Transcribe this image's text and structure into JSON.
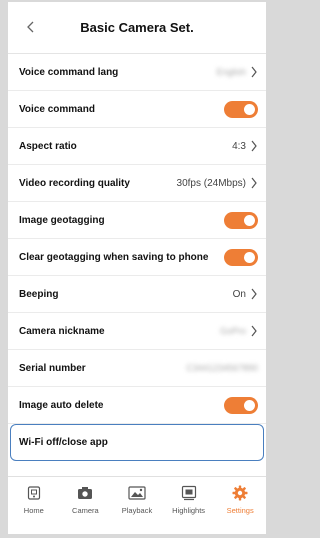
{
  "header": {
    "title": "Basic Camera Set."
  },
  "settings": [
    {
      "label": "Voice command lang",
      "value": "English",
      "type": "link-blurred"
    },
    {
      "label": "Voice command",
      "type": "toggle",
      "on": true
    },
    {
      "label": "Aspect ratio",
      "value": "4:3",
      "type": "link"
    },
    {
      "label": "Video recording quality",
      "value": "30fps (24Mbps)",
      "type": "link"
    },
    {
      "label": "Image geotagging",
      "type": "toggle",
      "on": true
    },
    {
      "label": "Clear geotagging when saving to phone",
      "type": "toggle",
      "on": true
    },
    {
      "label": "Beeping",
      "value": "On",
      "type": "link"
    },
    {
      "label": "Camera nickname",
      "value": "GoPro",
      "type": "link-blurred"
    },
    {
      "label": "Serial number",
      "value": "C3441234567890",
      "type": "static-blurred"
    },
    {
      "label": "Image auto delete",
      "type": "toggle",
      "on": true
    },
    {
      "label": "Wi-Fi off/close app",
      "type": "action"
    }
  ],
  "tabbar": {
    "items": [
      {
        "label": "Home",
        "icon": "home-icon"
      },
      {
        "label": "Camera",
        "icon": "camera-icon"
      },
      {
        "label": "Playback",
        "icon": "playback-icon"
      },
      {
        "label": "Highlights",
        "icon": "highlights-icon"
      },
      {
        "label": "Settings",
        "icon": "gear-icon",
        "active": true
      }
    ]
  },
  "colors": {
    "accent": "#ee7e36",
    "selected_border": "#4a7fbf"
  }
}
